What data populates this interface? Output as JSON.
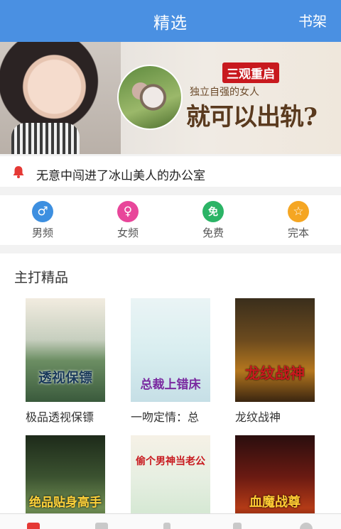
{
  "header": {
    "title": "精选",
    "shelf_label": "书架"
  },
  "banner": {
    "tag": "三观重启",
    "line1": "独立自强的女人",
    "line2": "就可以出轨?",
    "slides_total": 4,
    "active_slide": 1
  },
  "notice": {
    "icon": "bell-icon",
    "text": "无意中闯进了冰山美人的办公室"
  },
  "categories": [
    {
      "label": "男频",
      "icon": "male-icon",
      "glyph": "♂",
      "color": "#3d8fe0"
    },
    {
      "label": "女频",
      "icon": "female-icon",
      "glyph": "♀",
      "color": "#e8469a"
    },
    {
      "label": "免费",
      "icon": "free-icon",
      "glyph": "免",
      "color": "#2bb466"
    },
    {
      "label": "完本",
      "icon": "star-icon",
      "glyph": "☆",
      "color": "#f5a623"
    }
  ],
  "section": {
    "title": "主打精品",
    "books": [
      {
        "title": "极品透视保镖",
        "cover_text": "透视保镖"
      },
      {
        "title": "一吻定情：总",
        "cover_text": "总裁上错床"
      },
      {
        "title": "龙纹战神",
        "cover_text": "龙纹战神"
      },
      {
        "title": "",
        "cover_text": "绝品贴身高手"
      },
      {
        "title": "",
        "cover_text": "偷个男神当老公"
      },
      {
        "title": "",
        "cover_text": "血魔战尊"
      }
    ]
  },
  "colors": {
    "header": "#4a90e2",
    "accent_red": "#e53935"
  }
}
